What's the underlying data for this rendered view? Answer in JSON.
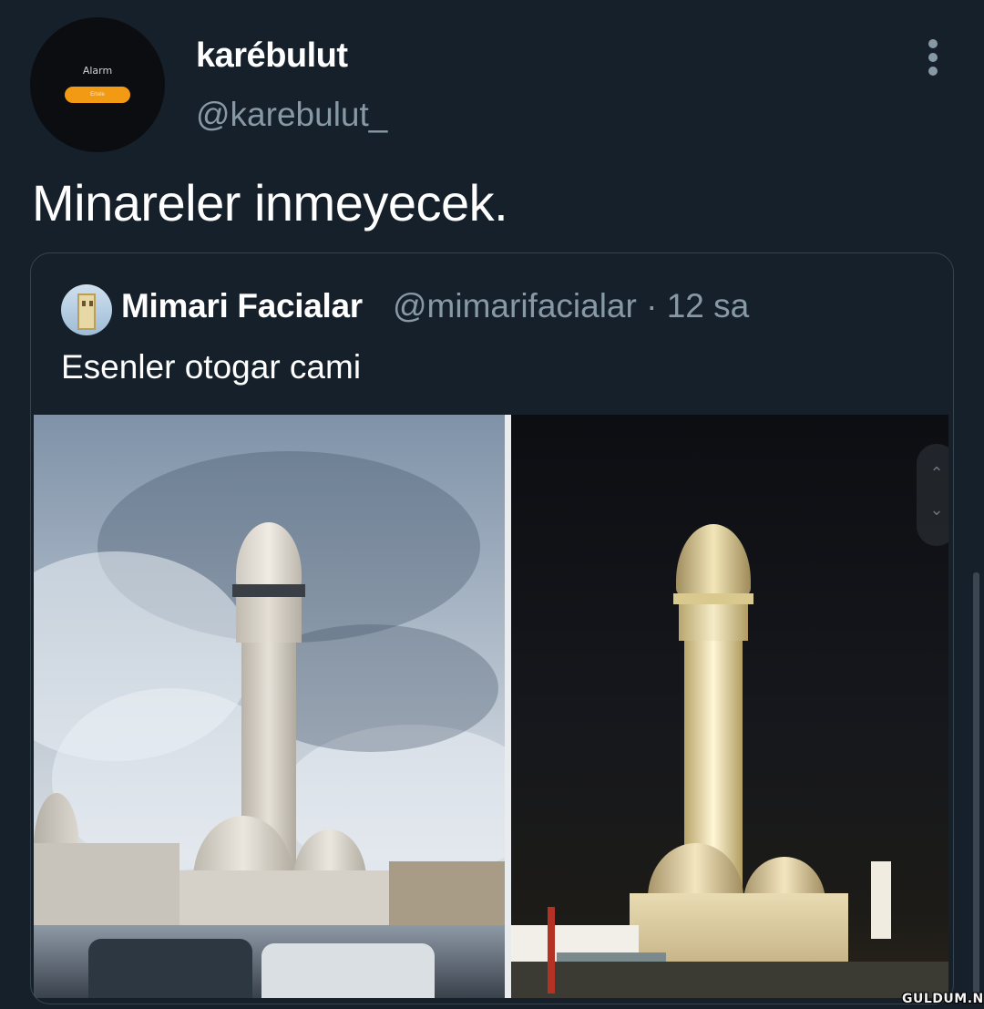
{
  "tweet": {
    "author": {
      "display_name": "karébulut",
      "handle": "@karebulut_",
      "avatar_caption": "Alarm",
      "avatar_button_label": "Ertele"
    },
    "text": "Minareler inmeyecek.",
    "menu_icon": "more-vertical-icon"
  },
  "quoted_tweet": {
    "author": {
      "display_name": "Mimari Facialar",
      "handle": "@mimarifacialar",
      "separator": "·",
      "time": "12 sa"
    },
    "text": "Esenler otogar cami",
    "media": [
      {
        "kind": "photo",
        "scene": "day"
      },
      {
        "kind": "photo",
        "scene": "night"
      }
    ],
    "media_overlay_icons": [
      "chevron-up-icon",
      "chevron-down-icon"
    ]
  },
  "watermark": "GULDUM.NET",
  "colors": {
    "background": "#15202b",
    "secondary_text": "#8899a6",
    "border": "#38444d",
    "primary_text": "#ffffff",
    "avatar_accent": "#f29a13"
  }
}
